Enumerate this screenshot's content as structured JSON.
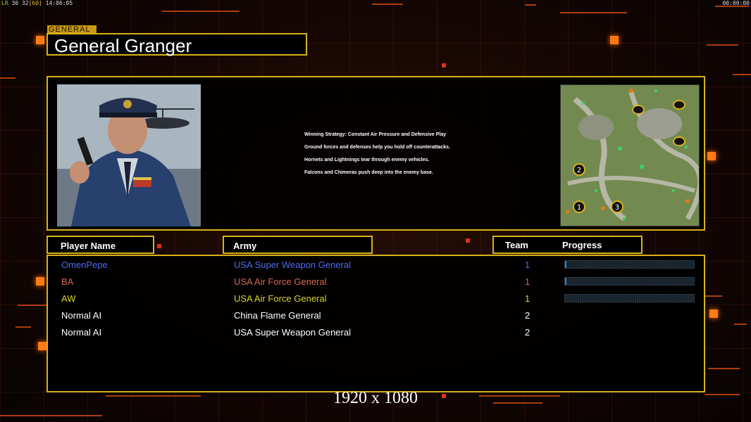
{
  "hud": {
    "fps_prefix": "LR",
    "fps_values": "30 32",
    "fps_bracket": "[60]",
    "clock": "14:06:05",
    "timer": "00:00:00"
  },
  "general": {
    "tag": "GENERAL",
    "name": "General Granger",
    "strategy": [
      "Winning Strategy: Constant Air Pressure and Defensive Play",
      "Ground forces and defenses help you hold off counterattacks.",
      "Hornets and Lightnings tear through enemy vehicles.",
      "Falcons and Chimeras push deep into the enemy base."
    ]
  },
  "minimap": {
    "start_positions": [
      "2",
      "1",
      "3"
    ]
  },
  "columns": {
    "player_name": "Player Name",
    "army": "Army",
    "team": "Team",
    "progress": "Progress"
  },
  "players": [
    {
      "name": "OmenPepe",
      "army": "USA Super Weapon General",
      "team": "1",
      "color": "#4a6cf0",
      "progress": 0.01
    },
    {
      "name": "BA",
      "army": "USA Air Force General",
      "team": "1",
      "color": "#d86a50",
      "progress": 0.01
    },
    {
      "name": "AW",
      "army": "USA Air Force General",
      "team": "1",
      "color": "#d8d830",
      "progress": 0.0
    },
    {
      "name": "Normal AI",
      "army": "China Flame General",
      "team": "2",
      "color": "#ffffff",
      "progress": null
    },
    {
      "name": "Normal AI",
      "army": "USA Super Weapon General",
      "team": "2",
      "color": "#ffffff",
      "progress": null
    }
  ],
  "resolution": "1920 x 1080",
  "colors": {
    "frame": "#d8b21a",
    "accent": "#ff7a14"
  }
}
